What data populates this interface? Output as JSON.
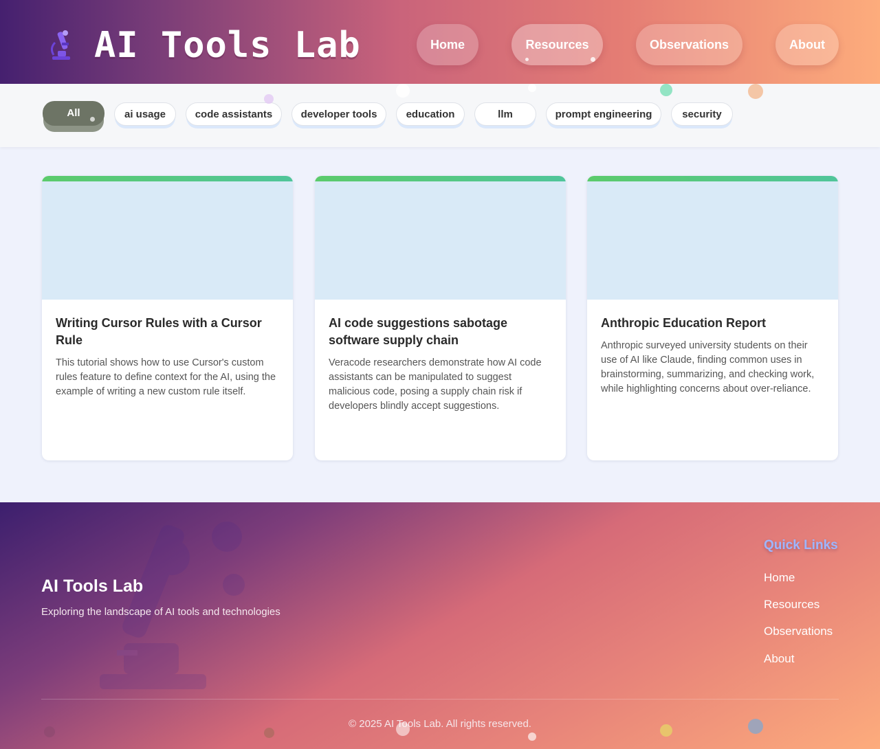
{
  "header": {
    "brand": "AI Tools Lab",
    "logo_icon": "microscope-icon",
    "nav": [
      {
        "label": "Home",
        "active": false
      },
      {
        "label": "Resources",
        "active": true
      },
      {
        "label": "Observations",
        "active": false
      },
      {
        "label": "About",
        "active": false
      }
    ]
  },
  "filters": {
    "selected": "All",
    "tags": [
      "All",
      "ai usage",
      "code assistants",
      "developer tools",
      "education",
      "llm",
      "prompt engineering",
      "security"
    ]
  },
  "cards": [
    {
      "title": "Writing Cursor Rules with a Cursor Rule",
      "description": "This tutorial shows how to use Cursor's custom rules feature to define context for the AI, using the example of writing a new custom rule itself."
    },
    {
      "title": "AI code suggestions sabotage software supply chain",
      "description": "Veracode researchers demonstrate how AI code assistants can be manipulated to suggest malicious code, posing a supply chain risk if developers blindly accept suggestions."
    },
    {
      "title": "Anthropic Education Report",
      "description": "Anthropic surveyed university students on their use of AI like Claude, finding common uses in brainstorming, summarizing, and checking work, while highlighting concerns about over-reliance."
    }
  ],
  "footer": {
    "title": "AI Tools Lab",
    "tagline": "Exploring the landscape of AI tools and technologies",
    "quick_links_title": "Quick Links",
    "quick_links": [
      "Home",
      "Resources",
      "Observations",
      "About"
    ],
    "copyright": "© 2025 AI Tools Lab. All rights reserved."
  },
  "colors": {
    "card_accent": "#5bcb6b",
    "active_chip": "#6d7465",
    "quick_links_title": "#9eb6ff"
  }
}
